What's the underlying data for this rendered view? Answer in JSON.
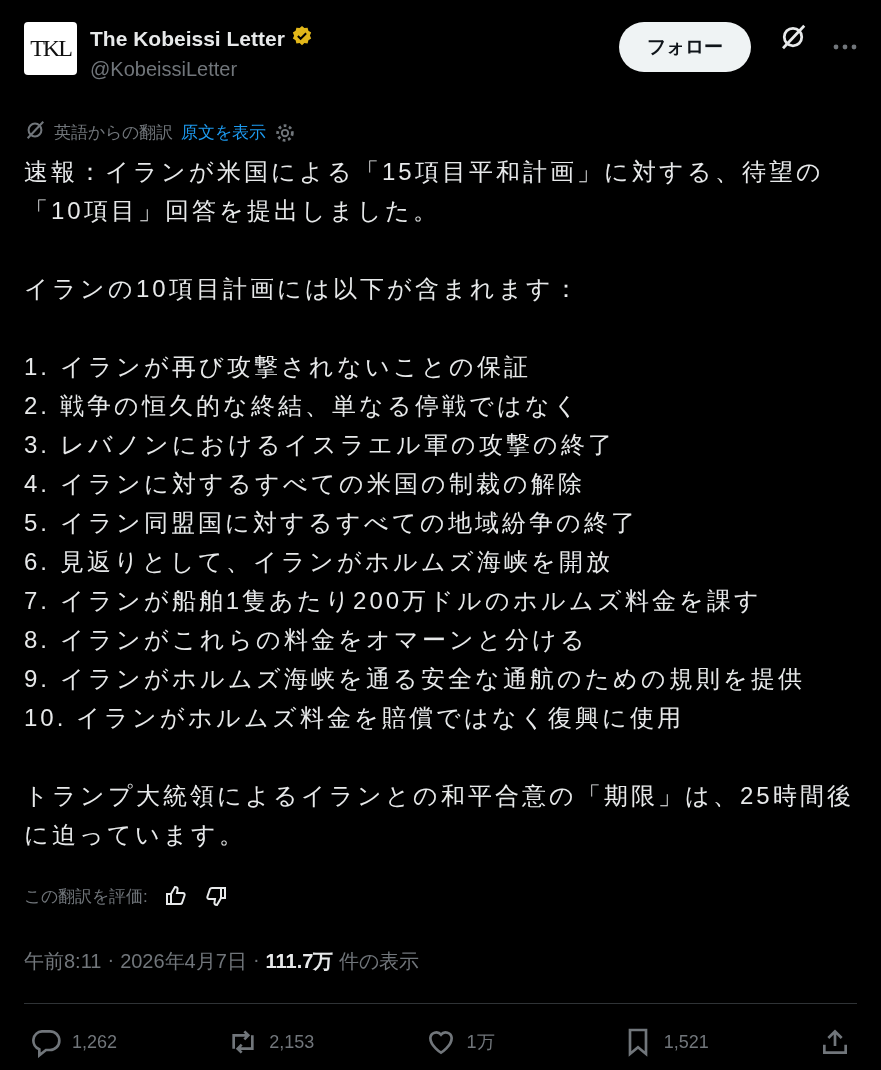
{
  "author": {
    "name": "The Kobeissi Letter",
    "handle": "@KobeissiLetter",
    "verified": true,
    "avatar_text": "TKL"
  },
  "follow_button": "フォロー",
  "translation": {
    "label": "英語からの翻訳",
    "link": "原文を表示"
  },
  "intro": "速報：イランが米国による「15項目平和計画」に対する、待望の「10項目」回答を提出しました。",
  "list_heading": "イランの10項目計画には以下が含まれます：",
  "items": [
    "1. イランが再び攻撃されないことの保証",
    "2. 戦争の恒久的な終結、単なる停戦ではなく",
    "3. レバノンにおけるイスラエル軍の攻撃の終了",
    "4. イランに対するすべての米国の制裁の解除",
    "5. イラン同盟国に対するすべての地域紛争の終了",
    "6. 見返りとして、イランがホルムズ海峡を開放",
    "7. イランが船舶1隻あたり200万ドルのホルムズ料金を課す",
    "8. イランがこれらの料金をオマーンと分ける",
    "9. イランがホルムズ海峡を通る安全な通航のための規則を提供",
    "10. イランがホルムズ料金を賠償ではなく復興に使用"
  ],
  "closing": "トランプ大統領によるイランとの和平合意の「期限」は、25時間後に迫っています。",
  "rating_label": "この翻訳を評価:",
  "meta": {
    "time": "午前8:11",
    "separator": "·",
    "date": "2026年4月7日",
    "views": "111.7万",
    "views_label": "件の表示"
  },
  "actions": [
    {
      "kind": "reply",
      "count": "1,262"
    },
    {
      "kind": "repost",
      "count": "2,153"
    },
    {
      "kind": "like",
      "count": "1万"
    },
    {
      "kind": "bookmark",
      "count": "1,521"
    },
    {
      "kind": "share"
    }
  ]
}
